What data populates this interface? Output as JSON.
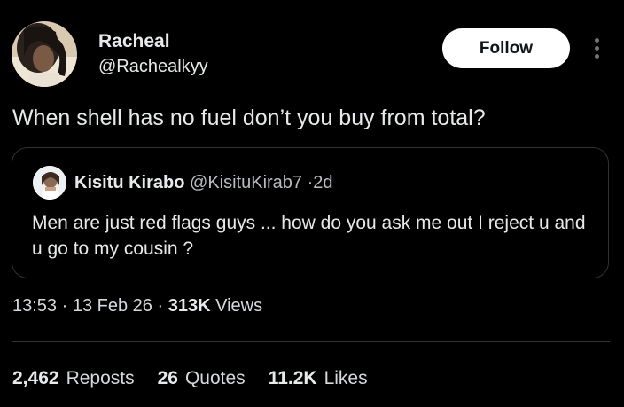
{
  "author": {
    "name": "Racheal",
    "handle": "@Rachealkyy"
  },
  "actions": {
    "follow_label": "Follow",
    "more_icon": "more-vertical-icon"
  },
  "tweet": {
    "text": "When shell has no fuel don’t you buy from total?"
  },
  "quote": {
    "name": "Kisitu Kirabo",
    "handle": "@KisituKirab7",
    "separator": "·",
    "time": "2d",
    "text": "Men are just red flags guys ... how do you ask me out I reject u and u go to my cousin ?"
  },
  "meta": {
    "time": "13:53",
    "sep1": "·",
    "date": "13 Feb 26",
    "sep2": "·",
    "views_count": "313K",
    "views_label": "Views"
  },
  "stats": {
    "reposts_count": "2,462",
    "reposts_label": "Reposts",
    "quotes_count": "26",
    "quotes_label": "Quotes",
    "likes_count": "11.2K",
    "likes_label": "Likes"
  },
  "colors": {
    "background": "#000000",
    "text": "#e7e9ea",
    "secondary": "#71767b",
    "border": "#2f3336",
    "button_bg": "#ffffff"
  }
}
